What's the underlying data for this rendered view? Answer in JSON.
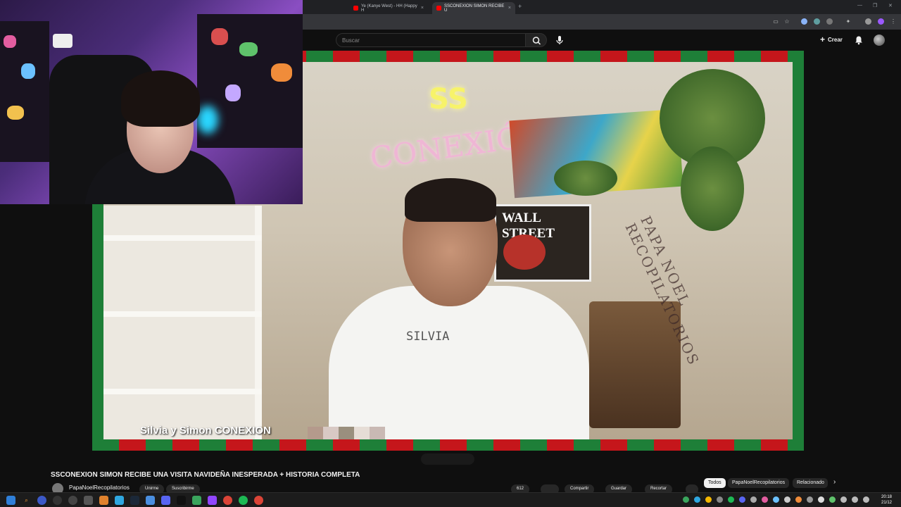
{
  "browser": {
    "tabs": [
      {
        "label": "Ye (Kanye West) - HH (Happy H",
        "active": false
      },
      {
        "label": "SSCONEXION SIMON RECIBE U",
        "active": true
      }
    ],
    "new_tab": "+",
    "tab_close": "×",
    "window_controls": [
      "—",
      "❐",
      "✕"
    ]
  },
  "youtube": {
    "search_placeholder": "Buscar",
    "create_label": "Crear",
    "video_caption": "Silvia y Simon CONEXION",
    "watermark_text": "PAPA NOEL RECOPILATORIOS",
    "neon_text": "CONEXIÓN",
    "neon_ss": "SS",
    "poster_text": "WALL STREET",
    "shirt_text": "SILVIA",
    "video_title": "SSCONEXION SIMON RECIBE UNA VISITA NAVIDEÑA INESPERADA + HISTORIA COMPLETA",
    "channel_name": "PapaNoelRecopilatorios",
    "action_buttons": [
      "Unirme",
      "Suscribirme",
      "612",
      "",
      "Compartir",
      "Guardar",
      "Recortar"
    ],
    "chips": [
      "Todos",
      "PapaNoelRecopilatorios",
      "Relacionado"
    ],
    "chips_next": "›"
  },
  "taskbar": {
    "clock_time": "20:18",
    "clock_date": "21/12"
  },
  "colors": {
    "frame_green": "#1e7f38",
    "frame_red": "#c5161b",
    "yt_bg": "#0f0f0f",
    "webcam_purple": "#8a4ec2"
  }
}
